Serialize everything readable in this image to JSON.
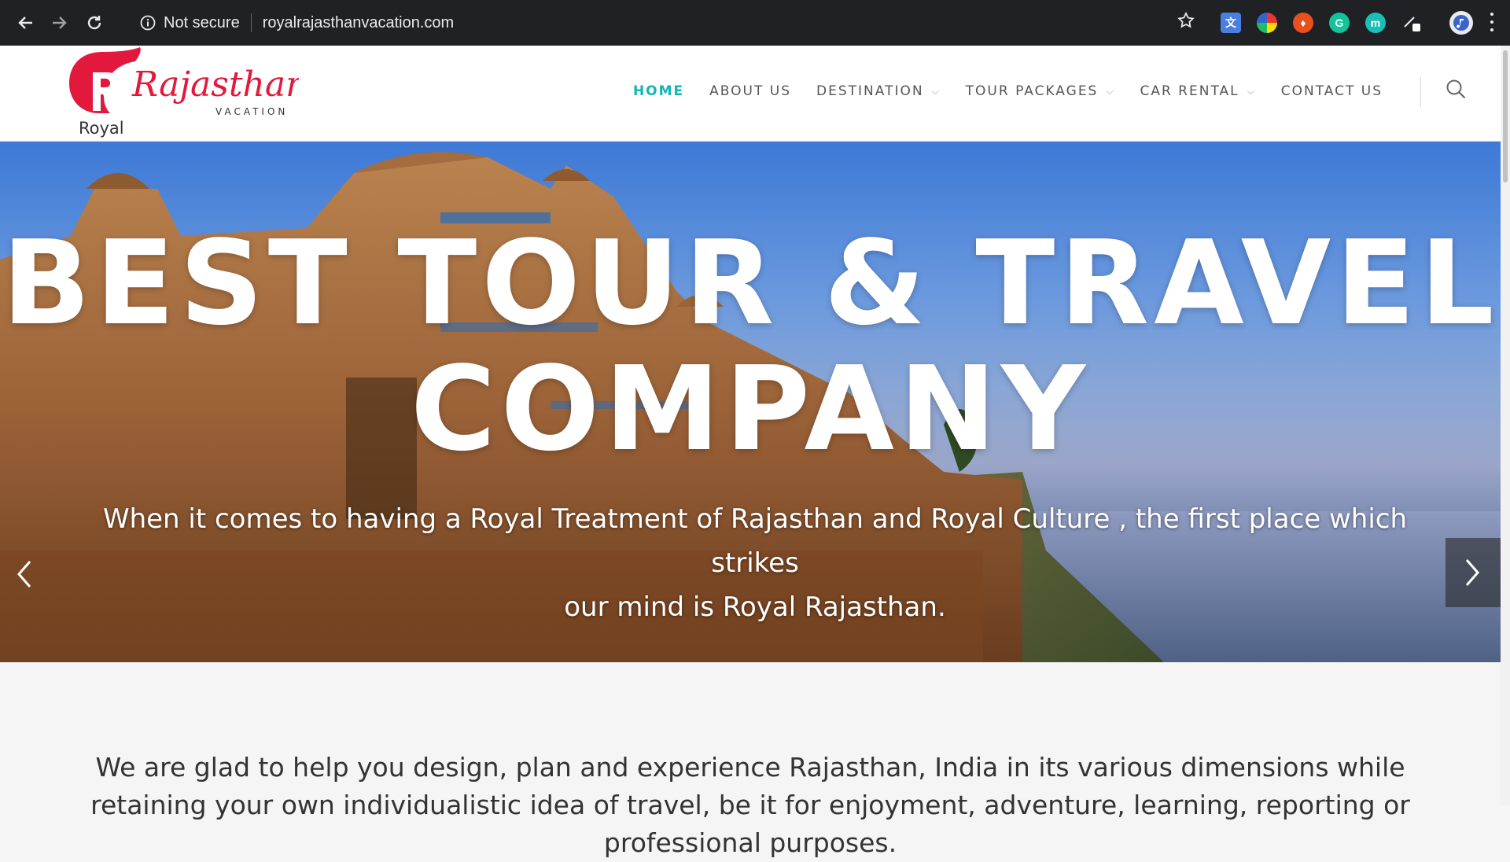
{
  "browser": {
    "security_label": "Not secure",
    "url": "royalrajasthanvacation.com",
    "icons": [
      "back-arrow-icon",
      "forward-arrow-icon",
      "reload-icon",
      "info-icon",
      "star-icon",
      "translate-extension-icon",
      "color-extension-icon",
      "fire-extension-icon",
      "grammarly-extension-icon",
      "m-extension-icon",
      "pen-extension-icon",
      "profile-avatar-icon",
      "kebab-menu-icon"
    ],
    "ext_grammarly_letter": "G",
    "ext_m_letter": "m"
  },
  "logo": {
    "line1": "Rajasthan",
    "line2": "VACATION",
    "line3": "Royal",
    "mark": "R"
  },
  "nav": {
    "items": [
      {
        "label": "HOME",
        "active": true,
        "dropdown": false
      },
      {
        "label": "ABOUT US",
        "active": false,
        "dropdown": false
      },
      {
        "label": "DESTINATION",
        "active": false,
        "dropdown": true
      },
      {
        "label": "TOUR PACKAGES",
        "active": false,
        "dropdown": true
      },
      {
        "label": "CAR RENTAL",
        "active": false,
        "dropdown": true
      },
      {
        "label": "CONTACT US",
        "active": false,
        "dropdown": false
      }
    ],
    "accent": "#13b5b1"
  },
  "hero": {
    "title_line1": "BEST TOUR & TRAVEL",
    "title_line2": "COMPANY",
    "subtitle_line1": "When it comes to having a Royal Treatment of Rajasthan and Royal Culture , the first place which strikes",
    "subtitle_line2": "our mind is Royal Rajasthan."
  },
  "intro": {
    "text": "We are glad to help you design, plan and experience Rajasthan, India in its various dimensions while retaining your own individualistic idea of travel, be it for enjoyment, adventure, learning, reporting or professional purposes."
  }
}
